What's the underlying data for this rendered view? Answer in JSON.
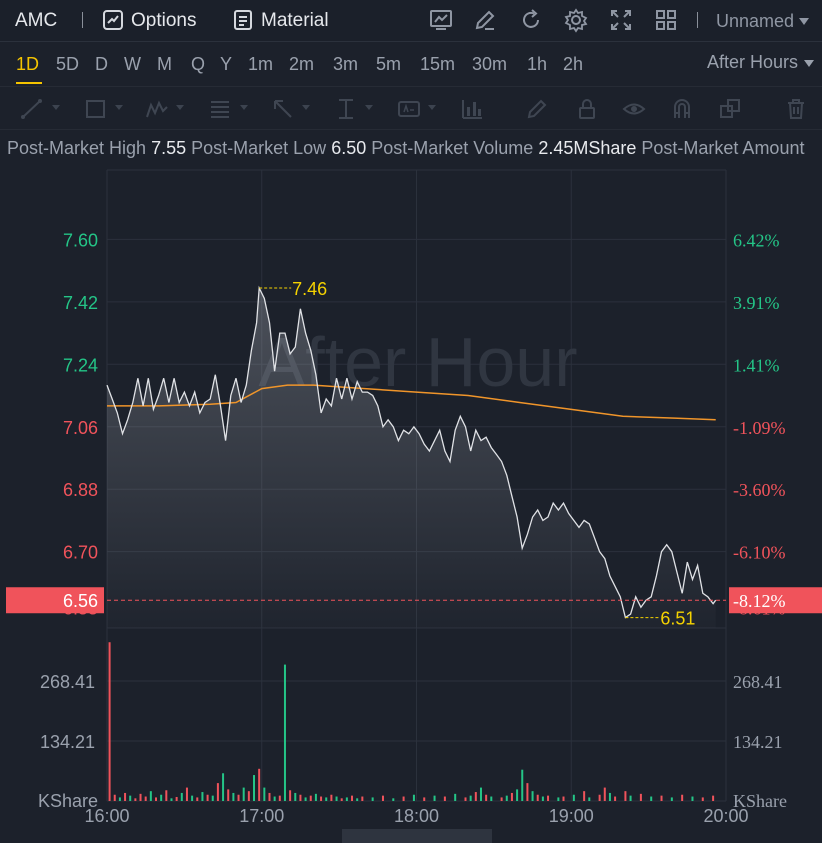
{
  "topbar": {
    "symbol": "AMC",
    "options_label": "Options",
    "material_label": "Material",
    "layout_name": "Unnamed"
  },
  "periods": [
    "1D",
    "5D",
    "D",
    "W",
    "M",
    "Q",
    "Y",
    "1m",
    "2m",
    "3m",
    "5m",
    "15m",
    "30m",
    "1h",
    "2h"
  ],
  "active_period": "1D",
  "session_dropdown": "After Hours",
  "info": {
    "high_label": "Post-Market High",
    "high_value": "7.55",
    "low_label": "Post-Market Low",
    "low_value": "6.50",
    "volume_label": "Post-Market Volume",
    "volume_value": "2.45MShare",
    "more_label": "Post-Market Amount"
  },
  "colors": {
    "up": "#24c587",
    "down": "#f0535b",
    "price_line": "#e0e2e6",
    "avg_line": "#f0952a",
    "marker": "#f5d200",
    "accent": "#f5c400"
  },
  "chart_data": {
    "type": "line",
    "watermark": "After Hour",
    "x_ticks": [
      "16:00",
      "17:00",
      "18:00",
      "19:00",
      "20:00"
    ],
    "y_left_ticks": [
      "7.60",
      "7.42",
      "7.24",
      "7.06",
      "6.88",
      "6.70"
    ],
    "y_right_ticks": [
      "6.42%",
      "3.91%",
      "1.41%",
      "-1.09%",
      "-3.60%",
      "-6.10%"
    ],
    "current_price": "6.56",
    "current_change": "-8.12%",
    "hidden_price_tick": "6.55",
    "hidden_change_tick": "-8.61%",
    "high_marker": "7.46",
    "low_marker": "6.51",
    "ylim": [
      6.48,
      7.8
    ],
    "xlim": [
      0,
      240
    ],
    "price": [
      [
        0,
        7.18
      ],
      [
        2,
        7.14
      ],
      [
        4,
        7.1
      ],
      [
        6,
        7.04
      ],
      [
        8,
        7.08
      ],
      [
        10,
        7.13
      ],
      [
        12,
        7.2
      ],
      [
        14,
        7.12
      ],
      [
        16,
        7.2
      ],
      [
        18,
        7.11
      ],
      [
        20,
        7.15
      ],
      [
        22,
        7.2
      ],
      [
        24,
        7.13
      ],
      [
        26,
        7.2
      ],
      [
        28,
        7.13
      ],
      [
        30,
        7.16
      ],
      [
        32,
        7.12
      ],
      [
        34,
        7.16
      ],
      [
        36,
        7.1
      ],
      [
        38,
        7.13
      ],
      [
        40,
        7.14
      ],
      [
        42,
        7.21
      ],
      [
        44,
        7.12
      ],
      [
        46,
        7.02
      ],
      [
        48,
        7.15
      ],
      [
        50,
        7.2
      ],
      [
        52,
        7.13
      ],
      [
        54,
        7.18
      ],
      [
        56,
        7.28
      ],
      [
        58,
        7.36
      ],
      [
        59,
        7.46
      ],
      [
        61,
        7.43
      ],
      [
        63,
        7.36
      ],
      [
        65,
        7.22
      ],
      [
        67,
        7.33
      ],
      [
        69,
        7.33
      ],
      [
        71,
        7.27
      ],
      [
        73,
        7.29
      ],
      [
        75,
        7.4
      ],
      [
        77,
        7.33
      ],
      [
        79,
        7.28
      ],
      [
        81,
        7.21
      ],
      [
        83,
        7.1
      ],
      [
        85,
        7.14
      ],
      [
        87,
        7.12
      ],
      [
        89,
        7.2
      ],
      [
        91,
        7.14
      ],
      [
        93,
        7.2
      ],
      [
        95,
        7.14
      ],
      [
        97,
        7.19
      ],
      [
        99,
        7.16
      ],
      [
        101,
        7.16
      ],
      [
        103,
        7.15
      ],
      [
        105,
        7.12
      ],
      [
        107,
        7.06
      ],
      [
        109,
        7.08
      ],
      [
        111,
        7.06
      ],
      [
        113,
        7.02
      ],
      [
        115,
        7.05
      ],
      [
        117,
        7.04
      ],
      [
        119,
        7.06
      ],
      [
        121,
        7.04
      ],
      [
        123,
        7.01
      ],
      [
        125,
        6.99
      ],
      [
        127,
        7.02
      ],
      [
        129,
        7.05
      ],
      [
        131,
        6.99
      ],
      [
        133,
        6.96
      ],
      [
        135,
        7.05
      ],
      [
        137,
        7.09
      ],
      [
        139,
        7.06
      ],
      [
        141,
        6.99
      ],
      [
        143,
        7.05
      ],
      [
        145,
        7.02
      ],
      [
        147,
        7.03
      ],
      [
        149,
        7.0
      ],
      [
        151,
        6.98
      ],
      [
        153,
        6.96
      ],
      [
        155,
        6.92
      ],
      [
        157,
        6.86
      ],
      [
        159,
        6.8
      ],
      [
        161,
        6.71
      ],
      [
        163,
        6.75
      ],
      [
        165,
        6.8
      ],
      [
        167,
        6.82
      ],
      [
        169,
        6.79
      ],
      [
        171,
        6.8
      ],
      [
        173,
        6.84
      ],
      [
        175,
        6.82
      ],
      [
        177,
        6.84
      ],
      [
        179,
        6.81
      ],
      [
        181,
        6.79
      ],
      [
        183,
        6.77
      ],
      [
        185,
        6.79
      ],
      [
        187,
        6.78
      ],
      [
        189,
        6.74
      ],
      [
        191,
        6.7
      ],
      [
        193,
        6.68
      ],
      [
        195,
        6.63
      ],
      [
        197,
        6.6
      ],
      [
        199,
        6.57
      ],
      [
        201,
        6.51
      ],
      [
        203,
        6.52
      ],
      [
        205,
        6.57
      ],
      [
        207,
        6.54
      ],
      [
        209,
        6.56
      ],
      [
        211,
        6.57
      ],
      [
        213,
        6.63
      ],
      [
        215,
        6.7
      ],
      [
        217,
        6.72
      ],
      [
        219,
        6.7
      ],
      [
        221,
        6.64
      ],
      [
        223,
        6.58
      ],
      [
        225,
        6.67
      ],
      [
        227,
        6.62
      ],
      [
        229,
        6.66
      ],
      [
        231,
        6.58
      ],
      [
        233,
        6.57
      ],
      [
        235,
        6.55
      ],
      [
        236,
        6.56
      ]
    ],
    "avg_price": [
      [
        0,
        7.12
      ],
      [
        20,
        7.12
      ],
      [
        40,
        7.125
      ],
      [
        50,
        7.13
      ],
      [
        60,
        7.17
      ],
      [
        70,
        7.18
      ],
      [
        80,
        7.18
      ],
      [
        100,
        7.17
      ],
      [
        120,
        7.16
      ],
      [
        140,
        7.15
      ],
      [
        160,
        7.13
      ],
      [
        180,
        7.11
      ],
      [
        200,
        7.09
      ],
      [
        220,
        7.085
      ],
      [
        236,
        7.08
      ]
    ],
    "volume_ticks": [
      "268.41",
      "134.21"
    ],
    "volume_unit": "KShare",
    "volume_max": 360,
    "volume": [
      [
        1,
        355,
        "down"
      ],
      [
        3,
        14,
        "down"
      ],
      [
        5,
        8,
        "up"
      ],
      [
        7,
        18,
        "down"
      ],
      [
        9,
        12,
        "up"
      ],
      [
        11,
        6,
        "down"
      ],
      [
        13,
        16,
        "down"
      ],
      [
        15,
        10,
        "down"
      ],
      [
        17,
        22,
        "up"
      ],
      [
        19,
        8,
        "down"
      ],
      [
        21,
        14,
        "up"
      ],
      [
        23,
        24,
        "down"
      ],
      [
        25,
        6,
        "up"
      ],
      [
        27,
        9,
        "down"
      ],
      [
        29,
        18,
        "up"
      ],
      [
        31,
        30,
        "down"
      ],
      [
        33,
        12,
        "up"
      ],
      [
        35,
        8,
        "down"
      ],
      [
        37,
        20,
        "up"
      ],
      [
        39,
        14,
        "down"
      ],
      [
        41,
        12,
        "up"
      ],
      [
        43,
        40,
        "down"
      ],
      [
        45,
        62,
        "up"
      ],
      [
        47,
        26,
        "down"
      ],
      [
        49,
        18,
        "up"
      ],
      [
        51,
        14,
        "down"
      ],
      [
        53,
        30,
        "up"
      ],
      [
        55,
        22,
        "down"
      ],
      [
        57,
        58,
        "up"
      ],
      [
        59,
        72,
        "down"
      ],
      [
        61,
        30,
        "up"
      ],
      [
        63,
        18,
        "down"
      ],
      [
        65,
        10,
        "up"
      ],
      [
        67,
        12,
        "down"
      ],
      [
        69,
        305,
        "up"
      ],
      [
        71,
        24,
        "down"
      ],
      [
        73,
        18,
        "up"
      ],
      [
        75,
        14,
        "down"
      ],
      [
        77,
        8,
        "up"
      ],
      [
        79,
        12,
        "down"
      ],
      [
        81,
        16,
        "up"
      ],
      [
        83,
        10,
        "down"
      ],
      [
        85,
        8,
        "up"
      ],
      [
        87,
        14,
        "down"
      ],
      [
        89,
        10,
        "up"
      ],
      [
        91,
        6,
        "down"
      ],
      [
        93,
        8,
        "up"
      ],
      [
        95,
        12,
        "down"
      ],
      [
        97,
        6,
        "up"
      ],
      [
        99,
        10,
        "down"
      ],
      [
        103,
        8,
        "up"
      ],
      [
        107,
        12,
        "down"
      ],
      [
        111,
        6,
        "up"
      ],
      [
        115,
        10,
        "down"
      ],
      [
        119,
        14,
        "up"
      ],
      [
        123,
        8,
        "down"
      ],
      [
        127,
        12,
        "up"
      ],
      [
        131,
        10,
        "down"
      ],
      [
        135,
        16,
        "up"
      ],
      [
        139,
        8,
        "down"
      ],
      [
        141,
        12,
        "up"
      ],
      [
        143,
        20,
        "down"
      ],
      [
        145,
        30,
        "up"
      ],
      [
        147,
        14,
        "down"
      ],
      [
        149,
        10,
        "up"
      ],
      [
        153,
        8,
        "down"
      ],
      [
        155,
        12,
        "up"
      ],
      [
        157,
        18,
        "down"
      ],
      [
        159,
        26,
        "up"
      ],
      [
        161,
        70,
        "up"
      ],
      [
        163,
        40,
        "down"
      ],
      [
        165,
        22,
        "up"
      ],
      [
        167,
        14,
        "down"
      ],
      [
        169,
        10,
        "up"
      ],
      [
        171,
        12,
        "down"
      ],
      [
        175,
        8,
        "up"
      ],
      [
        177,
        10,
        "down"
      ],
      [
        181,
        14,
        "up"
      ],
      [
        185,
        22,
        "down"
      ],
      [
        187,
        8,
        "up"
      ],
      [
        191,
        14,
        "down"
      ],
      [
        193,
        30,
        "down"
      ],
      [
        195,
        18,
        "up"
      ],
      [
        197,
        10,
        "down"
      ],
      [
        201,
        22,
        "down"
      ],
      [
        203,
        12,
        "up"
      ],
      [
        207,
        16,
        "down"
      ],
      [
        211,
        10,
        "up"
      ],
      [
        215,
        12,
        "down"
      ],
      [
        219,
        8,
        "up"
      ],
      [
        223,
        14,
        "down"
      ],
      [
        227,
        10,
        "up"
      ],
      [
        231,
        8,
        "down"
      ],
      [
        235,
        12,
        "down"
      ]
    ]
  }
}
